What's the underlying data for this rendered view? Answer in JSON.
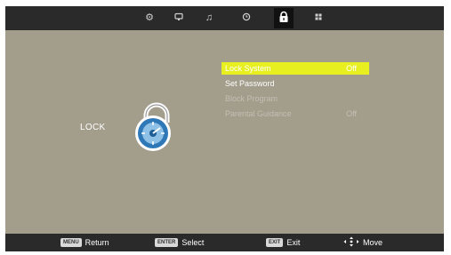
{
  "header": {
    "tabs": [
      {
        "icon": "settings-icon"
      },
      {
        "icon": "picture-icon"
      },
      {
        "icon": "sound-icon"
      },
      {
        "icon": "timer-icon"
      },
      {
        "icon": "lock-icon",
        "active": true
      },
      {
        "icon": "channel-grid-icon"
      }
    ]
  },
  "page": {
    "title": "LOCK"
  },
  "menu": {
    "items": [
      {
        "label": "Lock  System",
        "value": "Off"
      },
      {
        "label": "Set Password",
        "value": ""
      },
      {
        "label": "Block Program",
        "value": ""
      },
      {
        "label": "Parental Guidance",
        "value": "Off"
      }
    ]
  },
  "footer": {
    "hints": [
      {
        "key": "MENU",
        "label": "Return"
      },
      {
        "key": "ENTER",
        "label": "Select"
      },
      {
        "key": "EXIT",
        "label": "Exit"
      },
      {
        "key": "",
        "label": "Move"
      }
    ]
  },
  "colors": {
    "background": "#a39d8c",
    "bar": "#2a2a2a",
    "highlight": "#e7ef20"
  }
}
